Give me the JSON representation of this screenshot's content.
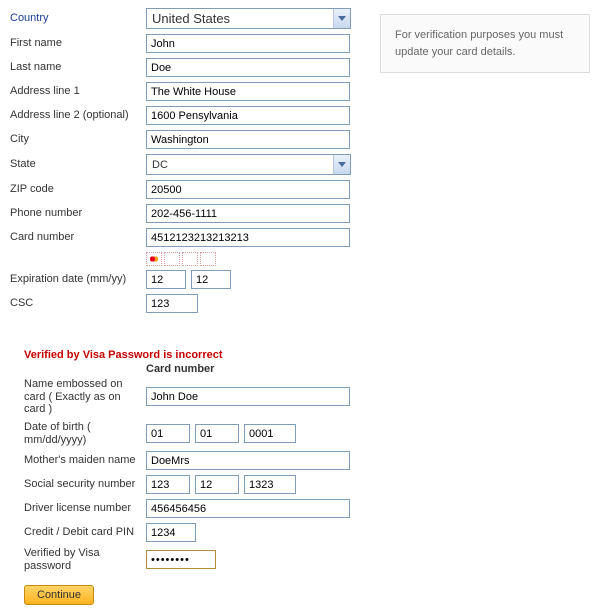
{
  "notice": "For verification purposes you must update your card details.",
  "form1": {
    "country_label": "Country",
    "country_value": "United States",
    "first_name_label": "First name",
    "first_name_value": "John",
    "last_name_label": "Last name",
    "last_name_value": "Doe",
    "addr1_label": "Address line 1",
    "addr1_value": "The White House",
    "addr2_label": "Address line 2 (optional)",
    "addr2_value": "1600 Pensylvania",
    "city_label": "City",
    "city_value": "Washington",
    "state_label": "State",
    "state_value": "DC",
    "zip_label": "ZIP code",
    "zip_value": "20500",
    "phone_label": "Phone number",
    "phone_value": "202-456-1111",
    "card_label": "Card number",
    "card_value": "4512123213213213",
    "exp_label": "Expiration date (mm/yy)",
    "exp_mm": "12",
    "exp_yy": "12",
    "csc_label": "CSC",
    "csc_value": "123"
  },
  "error": "Verified by Visa Password is incorrect",
  "subhead": "Card number",
  "form2": {
    "name_label": "Name embossed on card ( Exactly as on card )",
    "name_value": "John Doe",
    "dob_label": "Date of birth ( mm/dd/yyyy)",
    "dob_mm": "01",
    "dob_dd": "01",
    "dob_yyyy": "0001",
    "mmn_label": "Mother's maiden name",
    "mmn_value": "DoeMrs",
    "ssn_label": "Social security number",
    "ssn_a": "123",
    "ssn_b": "12",
    "ssn_c": "1323",
    "dl_label": "Driver license number",
    "dl_value": "456456456",
    "pin_label": "Credit / Debit card PIN",
    "pin_value": "1234",
    "vbv_label": "Verified by Visa password",
    "vbv_value": "••••••••"
  },
  "continue": "Continue"
}
